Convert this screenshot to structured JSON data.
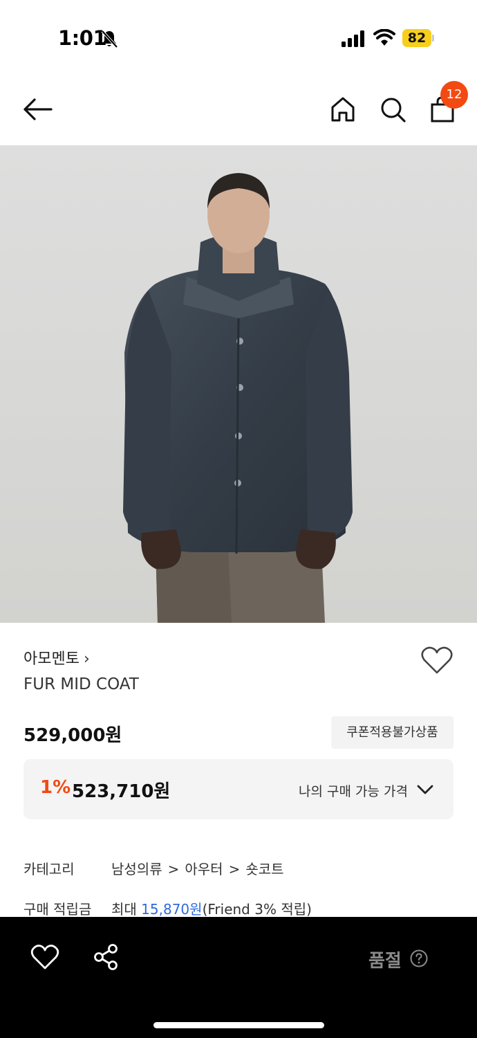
{
  "status_bar": {
    "time": "1:01",
    "battery": "82"
  },
  "header": {
    "cart_count": "12"
  },
  "product": {
    "brand": "아모멘토",
    "brand_chevron": "›",
    "name": "FUR MID COAT",
    "price": "529,000원",
    "coupon_tag": "쿠폰적용불가상품",
    "discount_percent": "1%",
    "discount_price": "523,710원",
    "my_price_label": "나의 구매 가능 가격"
  },
  "details": {
    "category_label": "카테고리",
    "category_path": [
      "남성의류",
      "아우터",
      "숏코트"
    ],
    "category_separator": ">",
    "points_label": "구매 적립금",
    "points_prefix": "최대",
    "points_amount": "15,870원",
    "points_suffix": "(Friend 3% 적립)"
  },
  "bottom_bar": {
    "soldout_label": "품절",
    "help_icon": "question-circle-icon"
  },
  "colors": {
    "accent": "#f24a12",
    "link_blue": "#2f6ae0",
    "bottom_bar": "#000000"
  }
}
